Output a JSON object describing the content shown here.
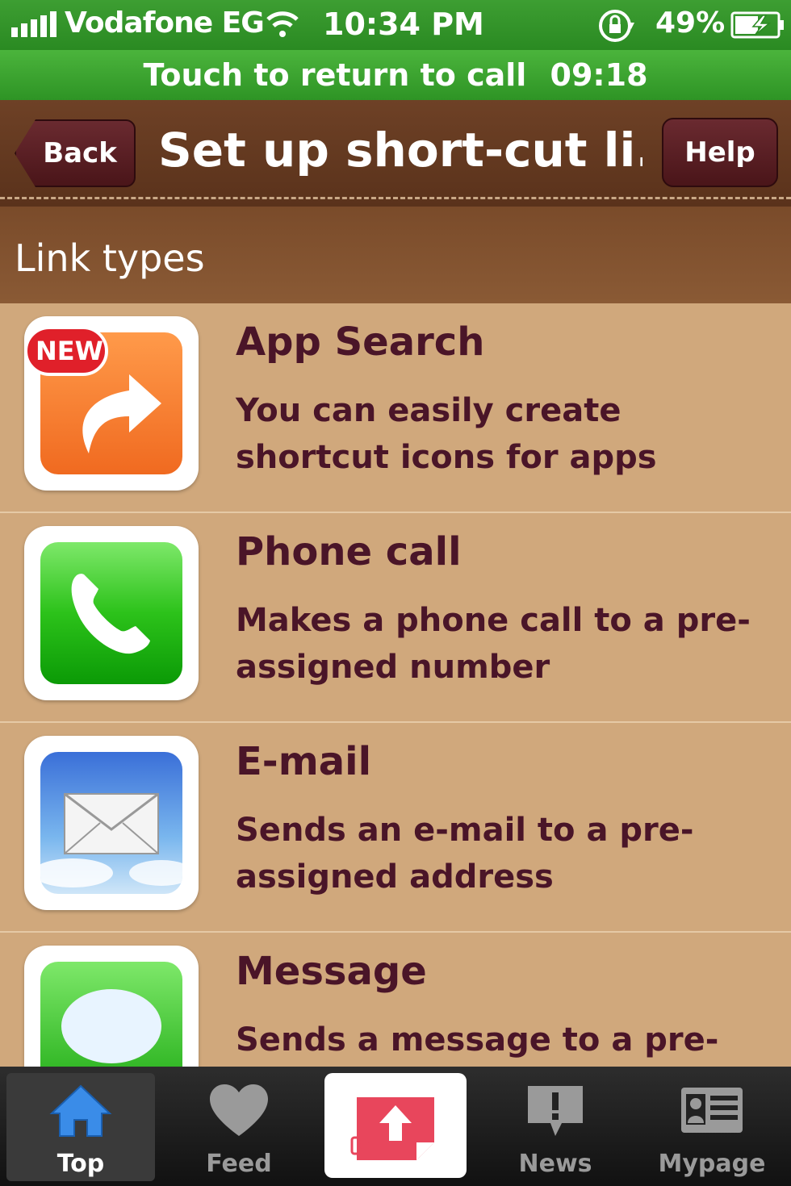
{
  "status_bar": {
    "carrier": "Vodafone EG",
    "time": "10:34 PM",
    "battery_percent": "49%"
  },
  "call_banner": {
    "text": "Touch to return to call",
    "duration": "09:18"
  },
  "nav": {
    "back_label": "Back",
    "title": "Set up short-cut li...",
    "help_label": "Help"
  },
  "section": {
    "header": "Link types"
  },
  "link_types": [
    {
      "title": "App Search",
      "description": "You can easily create shortcut icons for apps",
      "icon": "app-search-icon",
      "badge": "NEW"
    },
    {
      "title": "Phone call",
      "description": "Makes a phone call to a pre-assigned number",
      "icon": "phone-icon"
    },
    {
      "title": "E-mail",
      "description": "Sends an e-mail to a pre-assigned address",
      "icon": "mail-icon"
    },
    {
      "title": "Message",
      "description": "Sends a message to a pre-",
      "icon": "message-icon"
    }
  ],
  "tab_bar": {
    "tabs": [
      {
        "label": "Top",
        "icon": "home-icon",
        "active": true
      },
      {
        "label": "Feed",
        "icon": "heart-icon"
      },
      {
        "label": "",
        "icon": "post-upload-icon"
      },
      {
        "label": "News",
        "icon": "news-icon"
      },
      {
        "label": "Mypage",
        "icon": "profile-card-icon"
      }
    ]
  },
  "colors": {
    "status_green": "#2a8a22",
    "nav_brown": "#5a321b",
    "text_maroon": "#4a1528",
    "list_background": "#d0a87c"
  }
}
